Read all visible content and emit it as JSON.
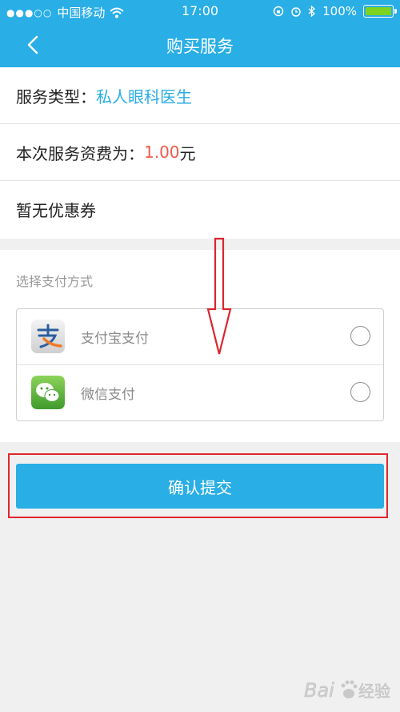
{
  "status_bar": {
    "carrier": "中国移动",
    "signal_dots": "●●●○○",
    "time": "17:00",
    "battery_percent": "100%",
    "battery_level": 1.0
  },
  "nav": {
    "title": "购买服务"
  },
  "service": {
    "type_label": "服务类型：",
    "type_value": "私人眼科医生",
    "fee_label": "本次服务资费为：",
    "fee_amount": "1.00",
    "fee_unit": "元",
    "coupon_text": "暂无优惠券"
  },
  "payment": {
    "caption": "选择支付方式",
    "methods": [
      {
        "label": "支付宝支付",
        "icon": "alipay-icon"
      },
      {
        "label": "微信支付",
        "icon": "wechat-icon"
      }
    ]
  },
  "confirm_label": "确认提交",
  "colors": {
    "brand_blue": "#29aee6",
    "fee_red": "#f05a4a",
    "highlight_red": "#e0262d",
    "battery_green": "#7ed321"
  }
}
